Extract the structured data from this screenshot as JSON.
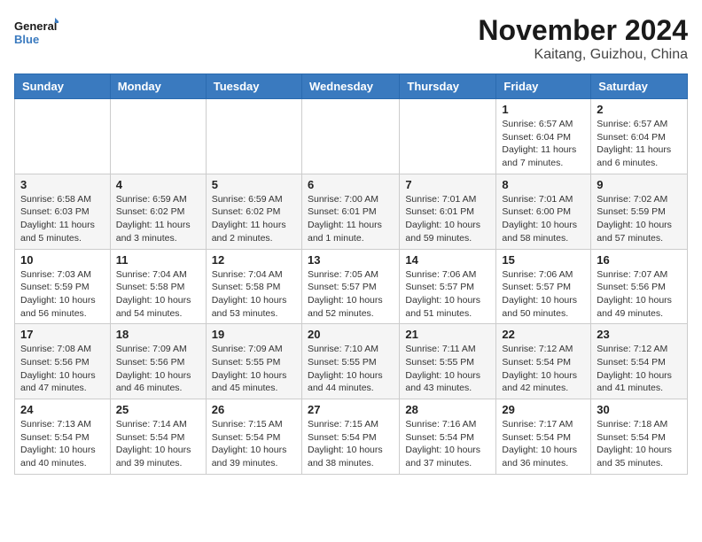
{
  "logo": {
    "line1": "General",
    "line2": "Blue"
  },
  "title": "November 2024",
  "location": "Kaitang, Guizhou, China",
  "weekdays": [
    "Sunday",
    "Monday",
    "Tuesday",
    "Wednesday",
    "Thursday",
    "Friday",
    "Saturday"
  ],
  "weeks": [
    [
      {
        "day": "",
        "info": ""
      },
      {
        "day": "",
        "info": ""
      },
      {
        "day": "",
        "info": ""
      },
      {
        "day": "",
        "info": ""
      },
      {
        "day": "",
        "info": ""
      },
      {
        "day": "1",
        "info": "Sunrise: 6:57 AM\nSunset: 6:04 PM\nDaylight: 11 hours\nand 7 minutes."
      },
      {
        "day": "2",
        "info": "Sunrise: 6:57 AM\nSunset: 6:04 PM\nDaylight: 11 hours\nand 6 minutes."
      }
    ],
    [
      {
        "day": "3",
        "info": "Sunrise: 6:58 AM\nSunset: 6:03 PM\nDaylight: 11 hours\nand 5 minutes."
      },
      {
        "day": "4",
        "info": "Sunrise: 6:59 AM\nSunset: 6:02 PM\nDaylight: 11 hours\nand 3 minutes."
      },
      {
        "day": "5",
        "info": "Sunrise: 6:59 AM\nSunset: 6:02 PM\nDaylight: 11 hours\nand 2 minutes."
      },
      {
        "day": "6",
        "info": "Sunrise: 7:00 AM\nSunset: 6:01 PM\nDaylight: 11 hours\nand 1 minute."
      },
      {
        "day": "7",
        "info": "Sunrise: 7:01 AM\nSunset: 6:01 PM\nDaylight: 10 hours\nand 59 minutes."
      },
      {
        "day": "8",
        "info": "Sunrise: 7:01 AM\nSunset: 6:00 PM\nDaylight: 10 hours\nand 58 minutes."
      },
      {
        "day": "9",
        "info": "Sunrise: 7:02 AM\nSunset: 5:59 PM\nDaylight: 10 hours\nand 57 minutes."
      }
    ],
    [
      {
        "day": "10",
        "info": "Sunrise: 7:03 AM\nSunset: 5:59 PM\nDaylight: 10 hours\nand 56 minutes."
      },
      {
        "day": "11",
        "info": "Sunrise: 7:04 AM\nSunset: 5:58 PM\nDaylight: 10 hours\nand 54 minutes."
      },
      {
        "day": "12",
        "info": "Sunrise: 7:04 AM\nSunset: 5:58 PM\nDaylight: 10 hours\nand 53 minutes."
      },
      {
        "day": "13",
        "info": "Sunrise: 7:05 AM\nSunset: 5:57 PM\nDaylight: 10 hours\nand 52 minutes."
      },
      {
        "day": "14",
        "info": "Sunrise: 7:06 AM\nSunset: 5:57 PM\nDaylight: 10 hours\nand 51 minutes."
      },
      {
        "day": "15",
        "info": "Sunrise: 7:06 AM\nSunset: 5:57 PM\nDaylight: 10 hours\nand 50 minutes."
      },
      {
        "day": "16",
        "info": "Sunrise: 7:07 AM\nSunset: 5:56 PM\nDaylight: 10 hours\nand 49 minutes."
      }
    ],
    [
      {
        "day": "17",
        "info": "Sunrise: 7:08 AM\nSunset: 5:56 PM\nDaylight: 10 hours\nand 47 minutes."
      },
      {
        "day": "18",
        "info": "Sunrise: 7:09 AM\nSunset: 5:56 PM\nDaylight: 10 hours\nand 46 minutes."
      },
      {
        "day": "19",
        "info": "Sunrise: 7:09 AM\nSunset: 5:55 PM\nDaylight: 10 hours\nand 45 minutes."
      },
      {
        "day": "20",
        "info": "Sunrise: 7:10 AM\nSunset: 5:55 PM\nDaylight: 10 hours\nand 44 minutes."
      },
      {
        "day": "21",
        "info": "Sunrise: 7:11 AM\nSunset: 5:55 PM\nDaylight: 10 hours\nand 43 minutes."
      },
      {
        "day": "22",
        "info": "Sunrise: 7:12 AM\nSunset: 5:54 PM\nDaylight: 10 hours\nand 42 minutes."
      },
      {
        "day": "23",
        "info": "Sunrise: 7:12 AM\nSunset: 5:54 PM\nDaylight: 10 hours\nand 41 minutes."
      }
    ],
    [
      {
        "day": "24",
        "info": "Sunrise: 7:13 AM\nSunset: 5:54 PM\nDaylight: 10 hours\nand 40 minutes."
      },
      {
        "day": "25",
        "info": "Sunrise: 7:14 AM\nSunset: 5:54 PM\nDaylight: 10 hours\nand 39 minutes."
      },
      {
        "day": "26",
        "info": "Sunrise: 7:15 AM\nSunset: 5:54 PM\nDaylight: 10 hours\nand 39 minutes."
      },
      {
        "day": "27",
        "info": "Sunrise: 7:15 AM\nSunset: 5:54 PM\nDaylight: 10 hours\nand 38 minutes."
      },
      {
        "day": "28",
        "info": "Sunrise: 7:16 AM\nSunset: 5:54 PM\nDaylight: 10 hours\nand 37 minutes."
      },
      {
        "day": "29",
        "info": "Sunrise: 7:17 AM\nSunset: 5:54 PM\nDaylight: 10 hours\nand 36 minutes."
      },
      {
        "day": "30",
        "info": "Sunrise: 7:18 AM\nSunset: 5:54 PM\nDaylight: 10 hours\nand 35 minutes."
      }
    ]
  ]
}
